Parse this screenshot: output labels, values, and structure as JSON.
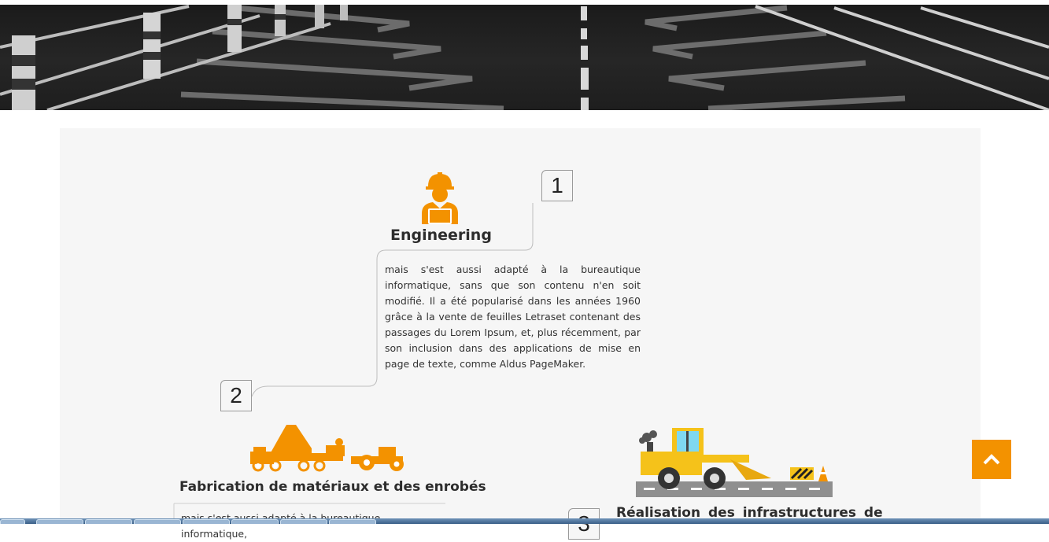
{
  "steps": [
    {
      "number": "1",
      "title": "Engineering",
      "text": "mais s'est aussi adapté à la bureautique informatique, sans que son contenu n'en soit modifié. Il a été popularisé dans les années 1960 grâce à la vente de feuilles Letraset contenant des passages du Lorem Ipsum, et, plus récemment, par son inclusion dans des applications de mise en page de texte, comme Aldus PageMaker.",
      "icon": "engineer-icon"
    },
    {
      "number": "2",
      "title": "Fabrication de matériaux et des enrobés",
      "text": "mais s'est aussi adapté à la bureautique informatique,",
      "icon": "road-machinery-icon"
    },
    {
      "number": "3",
      "title": "Réalisation des infrastructures de",
      "icon": "bulldozer-icon"
    }
  ],
  "back_to_top": {
    "icon": "chevron-up-icon"
  },
  "colors": {
    "accent": "#f39200",
    "panel": "#f6f6f6",
    "text": "#333333"
  }
}
